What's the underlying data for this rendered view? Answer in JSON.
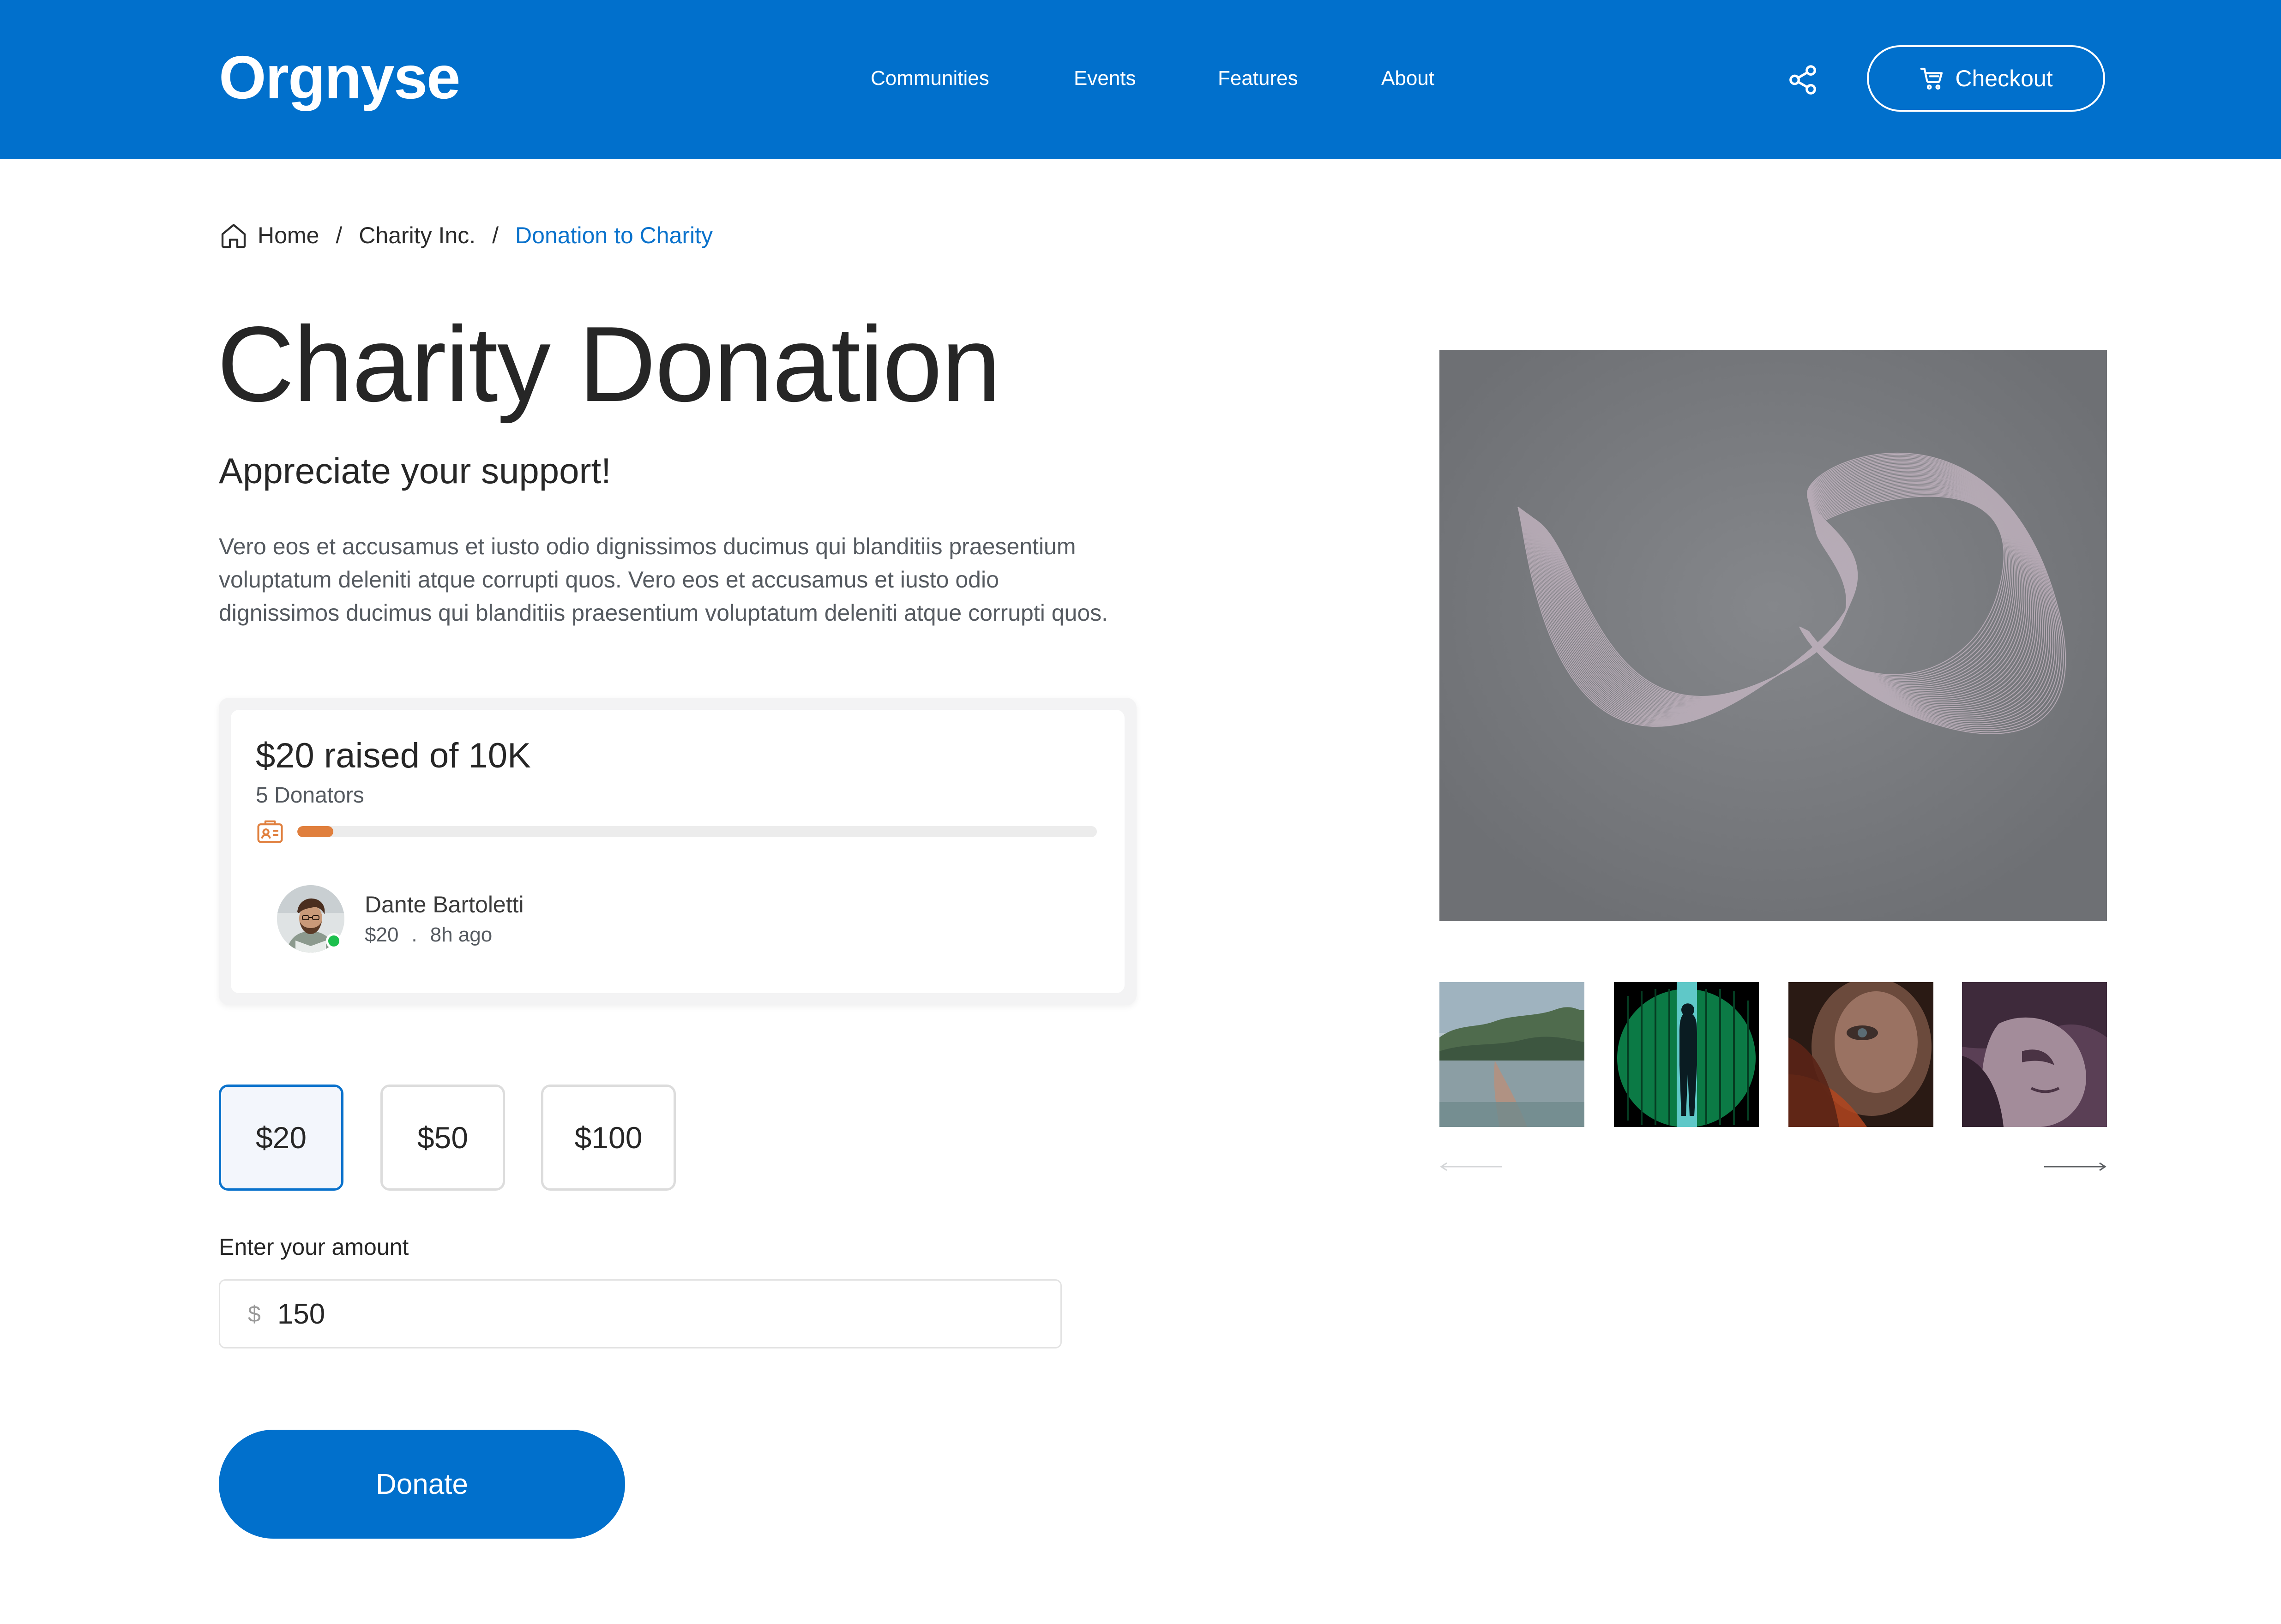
{
  "brand": {
    "name": "Orgnyse"
  },
  "nav": {
    "items": [
      {
        "label": "Communities"
      },
      {
        "label": "Events"
      },
      {
        "label": "Features"
      },
      {
        "label": "About"
      }
    ],
    "share_icon": "share-icon",
    "checkout_label": "Checkout",
    "checkout_icon": "cart-icon"
  },
  "breadcrumb": {
    "items": [
      {
        "label": "Home",
        "icon": "home-icon"
      },
      {
        "label": "Charity Inc."
      },
      {
        "label": "Donation to Charity"
      }
    ],
    "separator": "/"
  },
  "page": {
    "title": "Charity Donation",
    "subtitle": "Appreciate your support!",
    "description": "Vero eos et accusamus et iusto odio dignissimos ducimus qui blanditiis praesentium voluptatum deleniti atque corrupti quos. Vero eos et accusamus et iusto odio dignissimos ducimus qui blanditiis praesentium voluptatum deleniti atque corrupti quos."
  },
  "campaign": {
    "raised_text": "$20 raised of 10K",
    "donators_text": "5 Donators",
    "progress_fraction": 0.045,
    "recent_donor": {
      "name": "Dante Bartoletti",
      "amount": "$20",
      "separator": ".",
      "time": "8h ago",
      "online": true
    }
  },
  "donation_form": {
    "preset_amounts": [
      {
        "label": "$20",
        "selected": true
      },
      {
        "label": "$50",
        "selected": false
      },
      {
        "label": "$100",
        "selected": false
      }
    ],
    "amount_label": "Enter your amount",
    "currency_symbol": "$",
    "amount_value": "150",
    "donate_label": "Donate"
  },
  "gallery": {
    "thumbnails": [
      {
        "name": "thumbnail-watercolor-river"
      },
      {
        "name": "thumbnail-green-silhouette"
      },
      {
        "name": "thumbnail-face-portrait"
      },
      {
        "name": "thumbnail-purple-portrait"
      }
    ]
  },
  "colors": {
    "brand_blue": "#0170cc",
    "link_blue": "#0a72cc",
    "progress_orange": "#e07f3d",
    "online_green": "#1cbf4d"
  }
}
